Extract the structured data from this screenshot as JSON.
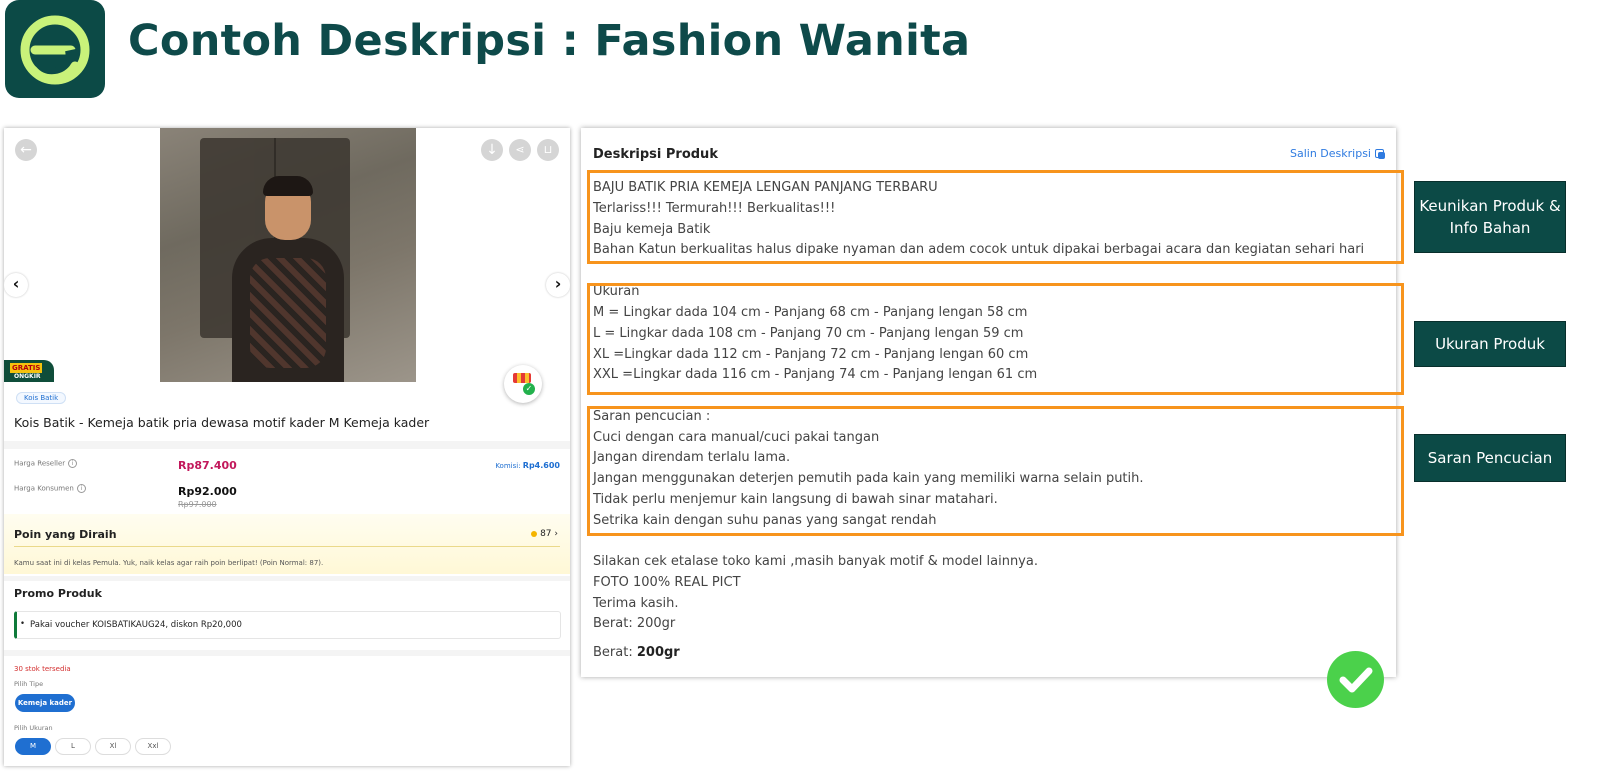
{
  "slide": {
    "title": "Contoh Deskripsi : Fashion Wanita",
    "logo_icon": "e-logo-icon",
    "accent_color": "#0c4a46",
    "highlight_color": "#f7941d"
  },
  "product_page": {
    "free_shipping_badge": {
      "line1": "GRATIS",
      "line2": "ONGKIR"
    },
    "store_chip": "Kois Batik",
    "product_name": "Kois Batik - Kemeja batik pria dewasa motif kader M Kemeja kader",
    "reseller_price_label": "Harga Reseller",
    "reseller_price": "Rp87.400",
    "commission_label": "Komisi:",
    "commission_value": "Rp4.600",
    "consumer_price_label": "Harga Konsumen",
    "consumer_price": "Rp92.000",
    "consumer_price_original": "Rp97.000",
    "points_title": "Poin yang Diraih",
    "points_value": "87",
    "points_note": "Kamu saat ini di kelas Pemula. Yuk, naik kelas agar raih poin berlipat! (Poin Normal: 87).",
    "promo_title": "Promo Produk",
    "promo_item": "Pakai voucher KOISBATIKAUG24, diskon Rp20,000",
    "stock": "30 stok tersedia",
    "type_label": "Pilih Tipe",
    "type_option": "Kemeja kader",
    "size_label": "Pilih Ukuran",
    "sizes": [
      "M",
      "L",
      "Xl",
      "Xxl"
    ]
  },
  "description": {
    "title": "Deskripsi Produk",
    "copy_label": "Salin Deskripsi",
    "lines": [
      "BAJU BATIK PRIA KEMEJA LENGAN PANJANG TERBARU",
      "Terlariss!!! Termurah!!! Berkualitas!!!",
      "Baju kemeja Batik",
      "Bahan Katun berkualitas halus dipake nyaman dan adem cocok untuk dipakai berbagai acara dan kegiatan sehari hari",
      "Ukuran",
      "M = Lingkar dada 104 cm - Panjang 68 cm - Panjang lengan 58 cm",
      "L = Lingkar dada 108 cm - Panjang 70 cm - Panjang lengan 59 cm",
      "XL =Lingkar dada 112 cm - Panjang 72 cm - Panjang lengan 60 cm",
      "XXL =Lingkar dada 116 cm - Panjang 74 cm - Panjang lengan 61 cm",
      "Saran pencucian :",
      "Cuci dengan cara manual/cuci pakai tangan",
      "Jangan direndam terlalu lama.",
      "Jangan menggunakan deterjen pemutih pada kain yang memiliki warna selain putih.",
      "Tidak perlu menjemur kain langsung di bawah sinar matahari.",
      "Setrika kain dengan suhu panas yang sangat rendah",
      "Silakan cek etalase toko kami ,masih banyak motif & model lainnya.",
      "FOTO 100% REAL PICT",
      "Terima kasih.",
      "Berat: 200gr"
    ],
    "weight_label": "Berat:",
    "weight_value": "200gr"
  },
  "tags": {
    "uniqueness": "Keunikan Produk & Info Bahan",
    "size": "Ukuran Produk",
    "washing": "Saran Pencucian"
  }
}
